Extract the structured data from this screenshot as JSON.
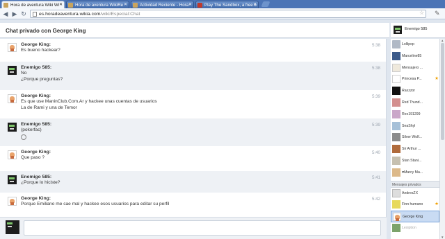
{
  "browser": {
    "tabs": [
      {
        "label": "Hora de aventura Wiki Wi",
        "active": true
      },
      {
        "label": "Hora de aventura WikiRe",
        "active": false
      },
      {
        "label": "Actividad Reciente - Hora",
        "active": false
      },
      {
        "label": "Play The Sandbox, a free o",
        "active": false
      }
    ],
    "url_host": "es.horadeaventura.wikia.com",
    "url_path": "/wiki/Especial:Chat"
  },
  "chat": {
    "title": "Chat privado con George King",
    "me": "Enemigo 585",
    "messages": [
      {
        "user": "George King:",
        "lines": [
          "Es bueno hackear?"
        ],
        "time": "5:38",
        "avatar": "george"
      },
      {
        "user": "Enemigo 585:",
        "lines": [
          "No",
          "¿Porque preguntas?"
        ],
        "time": "5:38",
        "avatar": "enemigo"
      },
      {
        "user": "George King:",
        "lines": [
          "Es que use ManinClub.Com.Ar y hackee unas cuentas de usuarios",
          "La de Rami y una de Temor"
        ],
        "time": "5:39",
        "avatar": "george"
      },
      {
        "user": "Enemigo 585:",
        "lines": [
          "(pokerfac)"
        ],
        "time": "5:39",
        "avatar": "enemigo",
        "emoticon": true
      },
      {
        "user": "George King:",
        "lines": [
          "Que paso ?"
        ],
        "time": "5:40",
        "avatar": "george"
      },
      {
        "user": "Enemigo 585:",
        "lines": [
          "¿Porque lo hiciste?"
        ],
        "time": "5:41",
        "avatar": "enemigo"
      },
      {
        "user": "George King:",
        "lines": [
          "Porque Emiliano me cae mal y hackee esos usuarios para editar su perfil"
        ],
        "time": "5:42",
        "avatar": "george"
      }
    ]
  },
  "userlist": {
    "users": [
      {
        "name": "Lollipop",
        "star": false
      },
      {
        "name": "Marceline85",
        "star": false
      },
      {
        "name": "Mensajero ...",
        "star": false
      },
      {
        "name": "Princesa P...",
        "star": true
      },
      {
        "name": "Raxzzor",
        "star": false
      },
      {
        "name": "Red Thund...",
        "star": false
      },
      {
        "name": "Rex191299",
        "star": false
      },
      {
        "name": "SeaShyl",
        "star": false
      },
      {
        "name": "Silver Wolf...",
        "star": false
      },
      {
        "name": "Sir Arthur ...",
        "star": false
      },
      {
        "name": "Stan Stani...",
        "star": false
      },
      {
        "name": "♥Marcy Ma...",
        "star": false
      }
    ],
    "private_label": "Mensajes privados",
    "private": [
      {
        "name": "AndresZX",
        "star": false
      },
      {
        "name": "Finn humano",
        "star": true
      },
      {
        "name": "George King",
        "star": false,
        "selected": true
      },
      {
        "name": "Lexiption",
        "star": false,
        "faded": true
      }
    ]
  }
}
